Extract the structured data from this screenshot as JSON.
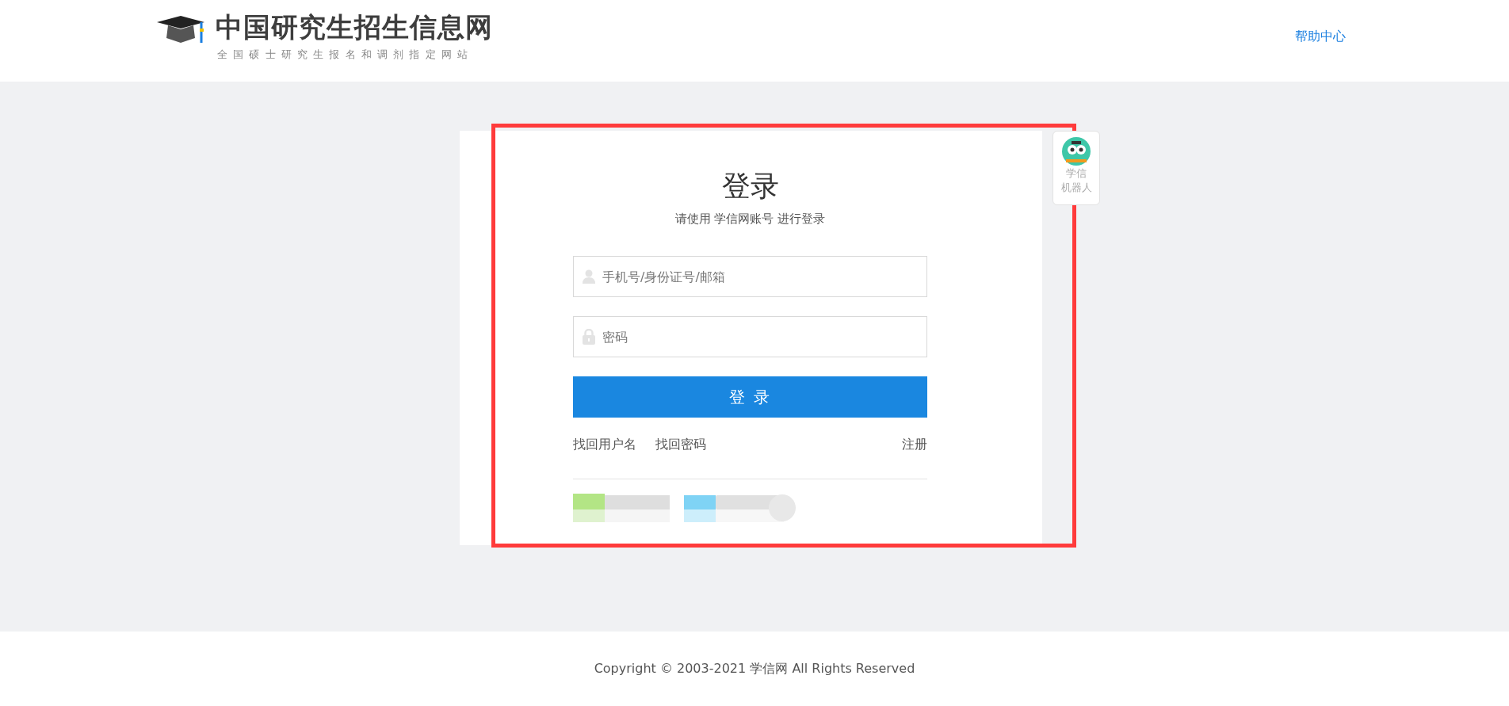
{
  "header": {
    "site_title": "中国研究生招生信息网",
    "site_subtitle": "全国硕士研究生报名和调剂指定网站",
    "help_link": "帮助中心"
  },
  "login": {
    "title": "登录",
    "subtitle": "请使用 学信网账号 进行登录",
    "fields": [
      {
        "kind": "user",
        "placeholder": "手机号/身份证号/邮箱"
      },
      {
        "kind": "password",
        "placeholder": "密码"
      }
    ],
    "submit": "登 录",
    "links": [
      "找回用户名",
      "找回密码",
      "注册"
    ]
  },
  "assistant": {
    "lines": [
      "学信",
      "机器人"
    ]
  },
  "footer": {
    "copyright": "Copyright © 2003-2021 学信网 All Rights Reserved"
  }
}
